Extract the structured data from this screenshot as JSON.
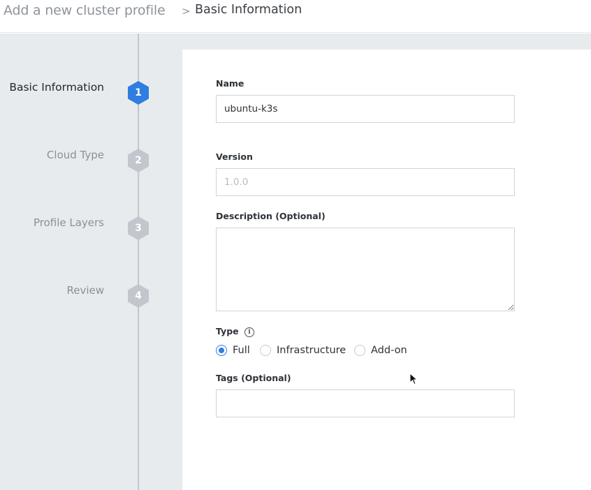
{
  "breadcrumb": {
    "root": "Add a new cluster profile",
    "separator": ">",
    "current": "Basic Information"
  },
  "steps": [
    {
      "label": "Basic Information",
      "number": "1",
      "active": true
    },
    {
      "label": "Cloud Type",
      "number": "2",
      "active": false
    },
    {
      "label": "Profile Layers",
      "number": "3",
      "active": false
    },
    {
      "label": "Review",
      "number": "4",
      "active": false
    }
  ],
  "form": {
    "name": {
      "label": "Name",
      "value": "ubuntu-k3s"
    },
    "version": {
      "label": "Version",
      "placeholder": "1.0.0"
    },
    "description": {
      "label": "Description (Optional)",
      "value": ""
    },
    "type": {
      "label": "Type",
      "info_icon": "i",
      "options": [
        {
          "label": "Full",
          "checked": true
        },
        {
          "label": "Infrastructure",
          "checked": false
        },
        {
          "label": "Add-on",
          "checked": false
        }
      ]
    },
    "tags": {
      "label": "Tags (Optional)",
      "value": ""
    }
  },
  "colors": {
    "accent": "#2f7de1",
    "step_active": "#2f7de1",
    "step_idle": "#c2c7cd"
  },
  "icons": {
    "step_shape": "hexagon",
    "info": "info-circle-icon",
    "cursor": "mouse-pointer-icon"
  }
}
